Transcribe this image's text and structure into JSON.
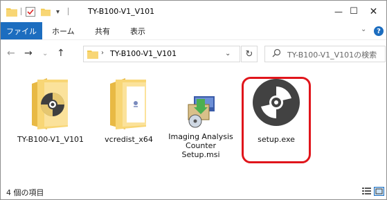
{
  "window": {
    "title": "TY-B100-V1_V101",
    "controls": {
      "minimize": "—",
      "maximize": "☐",
      "close": "✕"
    }
  },
  "ribbon": {
    "file_tab": "ファイル",
    "tabs": [
      "ホーム",
      "共有",
      "表示"
    ],
    "help": "?"
  },
  "navigation": {
    "address_path": "TY-B100-V1_V101",
    "search_placeholder": "TY-B100-V1_V101の検索"
  },
  "items": [
    {
      "name": "TY-B100-V1_V101",
      "type": "folder",
      "icon": "folder-disc-icon"
    },
    {
      "name": "vcredist_x64",
      "type": "folder",
      "icon": "folder-document-icon"
    },
    {
      "name": "Imaging Analysis Counter Setup.msi",
      "type": "msi",
      "icon": "installer-icon"
    },
    {
      "name": "setup.exe",
      "type": "exe",
      "icon": "disc-icon",
      "highlighted": true
    }
  ],
  "status": {
    "item_count": "4 個の項目"
  },
  "colors": {
    "accent": "#1c6dbf",
    "highlight": "#e0151b",
    "folder": "#f8d675"
  }
}
